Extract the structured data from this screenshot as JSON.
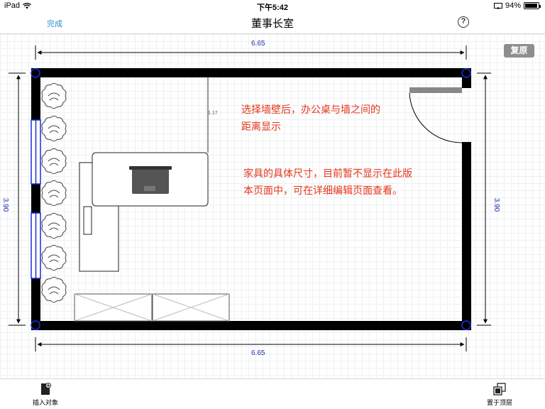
{
  "statusbar": {
    "device": "iPad",
    "time": "下午5:42",
    "battery": "94%",
    "battery_fraction": 0.94
  },
  "navbar": {
    "done_label": "完成",
    "title": "董事长室",
    "help_label": "?"
  },
  "canvas": {
    "restore_label": "复原",
    "dimensions": {
      "top": "6.65",
      "bottom": "6.65",
      "left": "3.90",
      "right": "3.90",
      "desk_to_wall": "1.17"
    },
    "annotations": {
      "line1": "选择墙壁后，办公桌与墙之间的",
      "line2": "距离显示",
      "line3": "家具的具体尺寸，目前暂不显示在此版",
      "line4": "本页面中，可在详细编辑页面查看。"
    },
    "colors": {
      "wall": "#000000",
      "dimension": "#1a2fb0",
      "annotation": "#e4361b",
      "window": "#1a2fd6"
    }
  },
  "toolbar": {
    "insert_label": "插入对象",
    "front_label": "置于顶层"
  }
}
